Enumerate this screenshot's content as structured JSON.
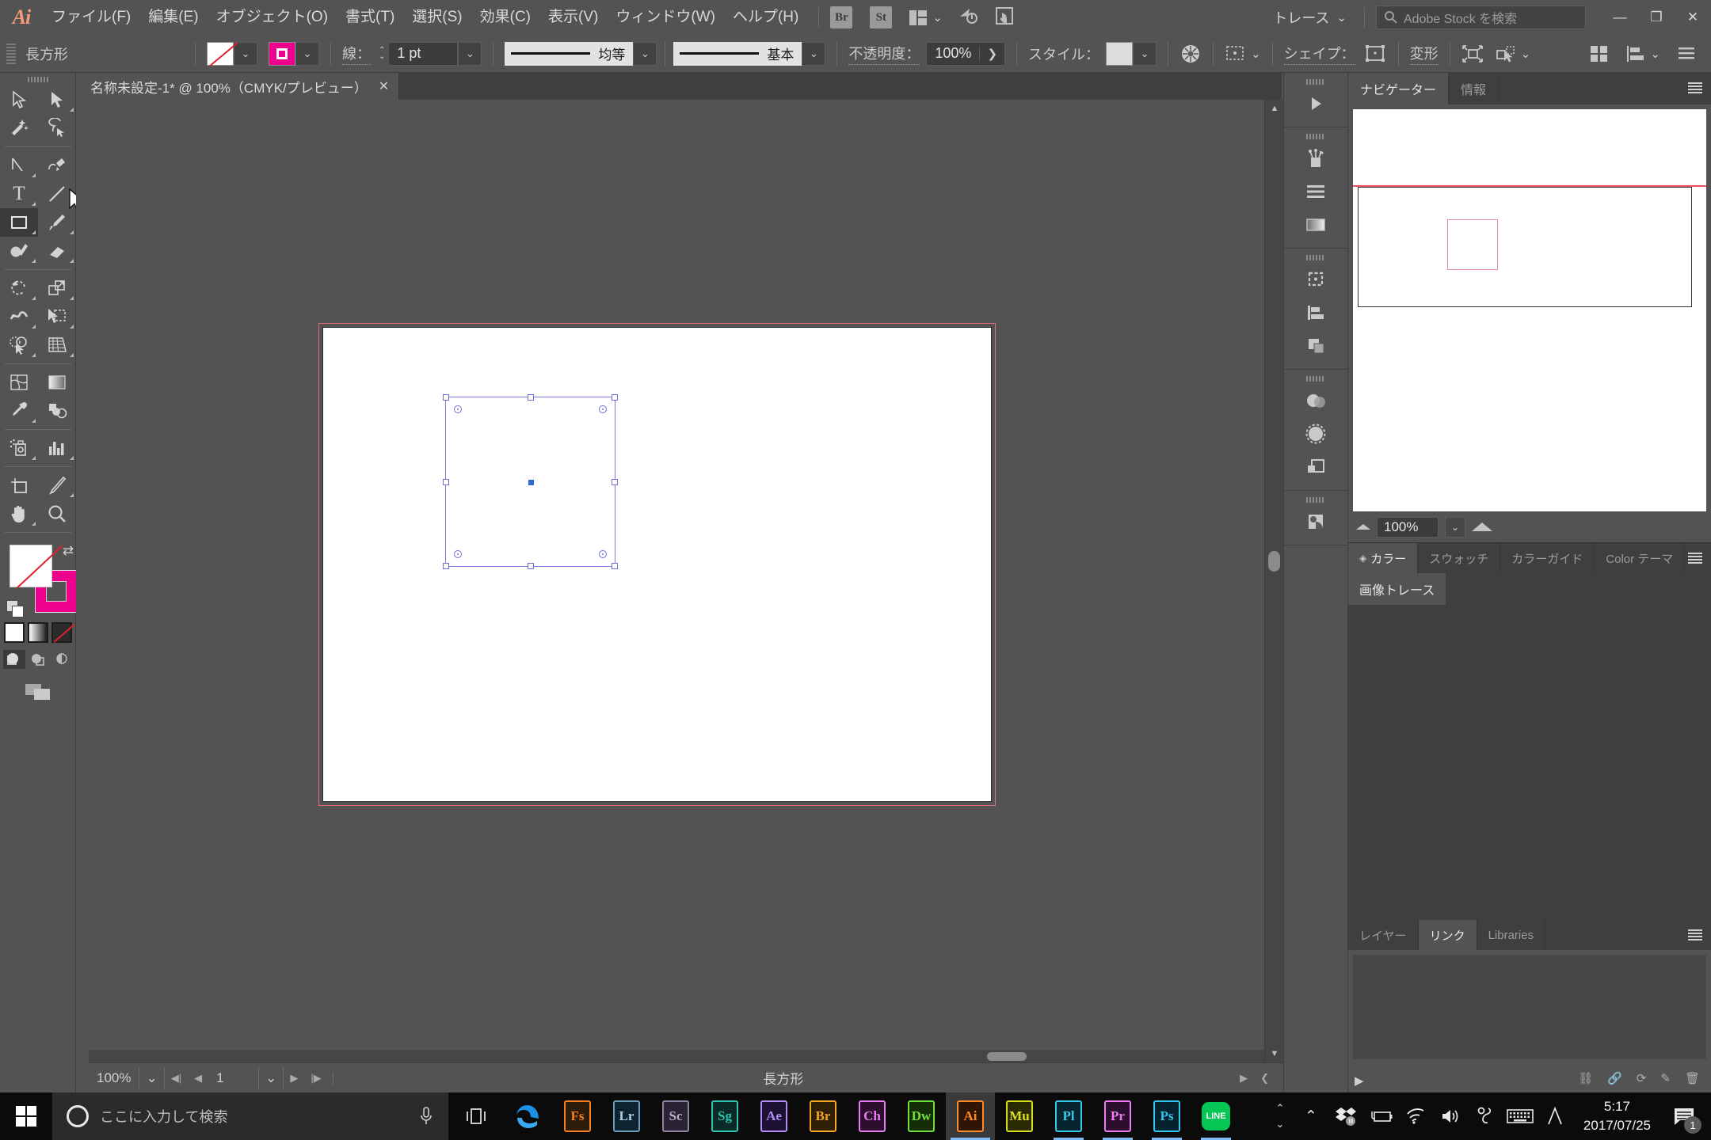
{
  "app": {
    "name": "Ai",
    "logo_color": "#f59b78"
  },
  "menubar": {
    "items": [
      {
        "label": "ファイル(F)"
      },
      {
        "label": "編集(E)"
      },
      {
        "label": "オブジェクト(O)"
      },
      {
        "label": "書式(T)"
      },
      {
        "label": "選択(S)"
      },
      {
        "label": "効果(C)"
      },
      {
        "label": "表示(V)"
      },
      {
        "label": "ウィンドウ(W)"
      },
      {
        "label": "ヘルプ(H)"
      }
    ],
    "bridge_label": "Br",
    "stock_label": "St",
    "trace_label": "トレース",
    "stock_search_placeholder": "Adobe Stock を検索",
    "minimize": "—",
    "restore": "❐",
    "close": "✕"
  },
  "controlbar": {
    "object_label": "長方形",
    "fill_swatch": "none",
    "stroke_swatch_color": "#ec008c",
    "stroke_label": "線：",
    "stroke_weight": "1 pt",
    "profile_label": "均等",
    "brush_label": "基本",
    "opacity_label": "不透明度：",
    "opacity_value": "100%",
    "style_label": "スタイル：",
    "shape_label": "シェイプ：",
    "transform_label": "変形"
  },
  "doctab": {
    "title": "名称未設定-1* @ 100%（CMYK/プレビュー）",
    "close": "✕"
  },
  "toolbar": {
    "tools": [
      {
        "name": "selection-tool"
      },
      {
        "name": "direct-selection-tool"
      },
      {
        "name": "magic-wand-tool"
      },
      {
        "name": "lasso-tool"
      },
      {
        "name": "pen-tool"
      },
      {
        "name": "curvature-tool"
      },
      {
        "name": "type-tool"
      },
      {
        "name": "line-segment-tool"
      },
      {
        "name": "rectangle-tool"
      },
      {
        "name": "paintbrush-tool"
      },
      {
        "name": "shaper-tool"
      },
      {
        "name": "eraser-tool"
      },
      {
        "name": "rotate-tool"
      },
      {
        "name": "scale-tool"
      },
      {
        "name": "width-tool"
      },
      {
        "name": "free-transform-tool"
      },
      {
        "name": "shape-builder-tool"
      },
      {
        "name": "perspective-grid-tool"
      },
      {
        "name": "mesh-tool"
      },
      {
        "name": "gradient-tool"
      },
      {
        "name": "eyedropper-tool"
      },
      {
        "name": "blend-tool"
      },
      {
        "name": "symbol-sprayer-tool"
      },
      {
        "name": "column-graph-tool"
      },
      {
        "name": "artboard-tool"
      },
      {
        "name": "slice-tool"
      },
      {
        "name": "hand-tool"
      },
      {
        "name": "zoom-tool"
      }
    ],
    "selected_tool": "rectangle-tool",
    "fill_color": "none",
    "stroke_color": "#ec008c",
    "color_modes": [
      "color",
      "gradient",
      "none"
    ],
    "draw_modes": [
      "draw-normal",
      "draw-behind",
      "draw-inside"
    ]
  },
  "canvas": {
    "artboard_bg": "#ffffff",
    "bleed_color": "#e26b7a",
    "selection_color": "#7b7ce0",
    "selected_shape": "rectangle"
  },
  "statusbar": {
    "zoom": "100%",
    "page": "1",
    "status_text": "長方形"
  },
  "panels": {
    "top_tabs": [
      {
        "label": "ナビゲーター",
        "active": true
      },
      {
        "label": "情報",
        "active": false
      }
    ],
    "navigator": {
      "zoom": "100%",
      "zoom_out_icon": "small-mountain-icon",
      "zoom_in_icon": "large-mountain-icon"
    },
    "color_tabs": [
      {
        "label": "カラー",
        "active": true
      },
      {
        "label": "スウォッチ",
        "active": false
      },
      {
        "label": "カラーガイド",
        "active": false
      },
      {
        "label": "Color テーマ",
        "active": false
      }
    ],
    "trace_tabs": [
      {
        "label": "画像トレース",
        "active": true
      }
    ],
    "layer_tabs": [
      {
        "label": "レイヤー",
        "active": false
      },
      {
        "label": "リンク",
        "active": true
      },
      {
        "label": "Libraries",
        "active": false
      }
    ]
  },
  "dock_icons": [
    {
      "name": "play-icon"
    },
    {
      "name": "brushes-icon"
    },
    {
      "name": "lines-icon"
    },
    {
      "name": "gradient-icon"
    },
    {
      "name": "artboards-icon"
    },
    {
      "name": "align-icon"
    },
    {
      "name": "pathfinder-icon"
    },
    {
      "name": "transparency-icon"
    },
    {
      "name": "appearance-icon"
    },
    {
      "name": "graphic-styles-icon"
    },
    {
      "name": "symbols-icon"
    }
  ],
  "taskbar": {
    "search_placeholder": "ここに入力して検索",
    "apps": [
      {
        "name": "edge",
        "label": "e",
        "color": "#1b8ee6",
        "border": "none"
      },
      {
        "name": "fuse",
        "label": "Fs",
        "color": "#f48020",
        "bg": "#2b1b08"
      },
      {
        "name": "lightroom",
        "label": "Lr",
        "color": "#a9d4e8",
        "bg": "#0d2330"
      },
      {
        "name": "scout",
        "label": "Sc",
        "color": "#b8aec9",
        "bg": "#2a2333"
      },
      {
        "name": "stock",
        "label": "Sg",
        "color": "#2ec4b0",
        "bg": "#0a2a26"
      },
      {
        "name": "after-effects",
        "label": "Ae",
        "color": "#b18cf5",
        "bg": "#1c1133"
      },
      {
        "name": "bridge",
        "label": "Br",
        "color": "#f5a623",
        "bg": "#2e1f05"
      },
      {
        "name": "character-animator",
        "label": "Ch",
        "color": "#e87df0",
        "bg": "#2c0e2f"
      },
      {
        "name": "dreamweaver",
        "label": "Dw",
        "color": "#6fe03a",
        "bg": "#152c08"
      },
      {
        "name": "illustrator",
        "label": "Ai",
        "color": "#ff8a28",
        "bg": "#2e1504",
        "active": true
      },
      {
        "name": "muse",
        "label": "Mu",
        "color": "#d8e01e",
        "bg": "#2a2a05"
      },
      {
        "name": "prelude",
        "label": "Pl",
        "color": "#36c9e8",
        "bg": "#07252e"
      },
      {
        "name": "premiere",
        "label": "Pr",
        "color": "#ec7df0",
        "bg": "#2c0e2f"
      },
      {
        "name": "photoshop",
        "label": "Ps",
        "color": "#31c5f0",
        "bg": "#04232e"
      },
      {
        "name": "line",
        "label": "LINE",
        "color": "#ffffff",
        "bg": "#06c755"
      }
    ],
    "tray": {
      "time": "5:17",
      "date": "2017/07/25",
      "notification_count": "1"
    }
  }
}
